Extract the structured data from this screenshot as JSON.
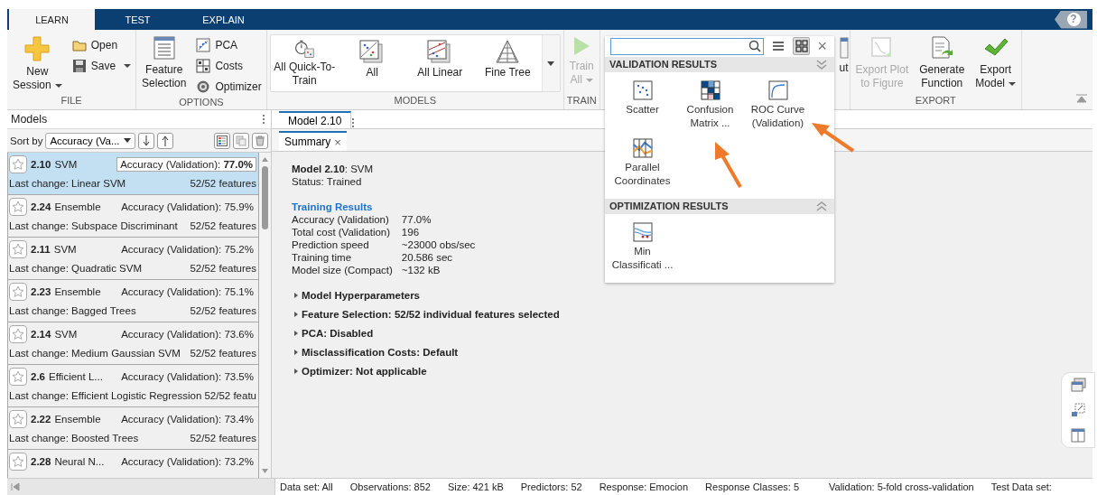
{
  "tabs": [
    {
      "label": "LEARN",
      "selected": true
    },
    {
      "label": "TEST",
      "selected": false
    },
    {
      "label": "EXPLAIN",
      "selected": false
    }
  ],
  "help_button": "?",
  "toolstrip": {
    "sections": [
      {
        "title": "FILE",
        "items": [
          {
            "kind": "large",
            "label": "New\nSession",
            "dropdown": true,
            "disabled": false
          },
          {
            "kind": "small",
            "label": "Open",
            "dropdown": false,
            "disabled": false
          },
          {
            "kind": "small",
            "label": "Save",
            "dropdown": true,
            "disabled": false
          }
        ]
      },
      {
        "title": "OPTIONS",
        "items": [
          {
            "kind": "large",
            "label": "Feature\nSelection",
            "dropdown": false,
            "disabled": false
          },
          {
            "kind": "small",
            "label": "PCA",
            "dropdown": false,
            "disabled": false
          },
          {
            "kind": "small",
            "label": "Costs",
            "dropdown": false,
            "disabled": false
          },
          {
            "kind": "small",
            "label": "Optimizer",
            "dropdown": false,
            "disabled": false
          }
        ]
      },
      {
        "title": "MODELS",
        "items": [
          {
            "kind": "gallery",
            "label": "All Quick-To-\nTrain",
            "dropdown": false,
            "disabled": false
          },
          {
            "kind": "gallery",
            "label": "All",
            "dropdown": false,
            "disabled": false
          },
          {
            "kind": "gallery",
            "label": "All Linear",
            "dropdown": false,
            "disabled": false
          },
          {
            "kind": "gallery",
            "label": "Fine Tree",
            "dropdown": false,
            "disabled": false
          }
        ]
      },
      {
        "title": "TRAIN",
        "items": [
          {
            "kind": "large",
            "label": "Train\nAll",
            "dropdown": true,
            "disabled": true
          }
        ]
      },
      {
        "items": [
          {
            "kind": "large",
            "label": "ut",
            "dropdown": false,
            "disabled": false
          }
        ]
      },
      {
        "title": "EXPORT",
        "items": [
          {
            "kind": "large",
            "label": "Export Plot\nto Figure",
            "dropdown": false,
            "disabled": true
          },
          {
            "kind": "large",
            "label": "Generate\nFunction",
            "dropdown": false,
            "disabled": false
          },
          {
            "kind": "large",
            "label": "Export\nModel",
            "dropdown": true,
            "disabled": false
          }
        ]
      }
    ]
  },
  "models_panel": {
    "title": "Models",
    "sort_label": "Sort by",
    "sort_value": "Accuracy (Va...",
    "models": [
      {
        "number": "2.10",
        "type": "SVM",
        "metric": "Accuracy (Validation): **77.0%**",
        "last_change": "Last change: Linear SVM",
        "features": "52/52 features",
        "selected": true
      },
      {
        "number": "2.24",
        "type": "Ensemble",
        "metric": "Accuracy (Validation): 75.9%",
        "last_change": "Last change: Subspace Discriminant",
        "features": "52/52 features",
        "selected": false
      },
      {
        "number": "2.11",
        "type": "SVM",
        "metric": "Accuracy (Validation): 75.2%",
        "last_change": "Last change: Quadratic SVM",
        "features": "52/52 features",
        "selected": false
      },
      {
        "number": "2.23",
        "type": "Ensemble",
        "metric": "Accuracy (Validation): 75.1%",
        "last_change": "Last change: Bagged Trees",
        "features": "52/52 features",
        "selected": false
      },
      {
        "number": "2.14",
        "type": "SVM",
        "metric": "Accuracy (Validation): 73.6%",
        "last_change": "Last change: Medium Gaussian SVM",
        "features": "52/52 features",
        "selected": false
      },
      {
        "number": "2.6",
        "type": "Efficient L...",
        "metric": "Accuracy (Validation): 73.5%",
        "last_change": "Last change: Efficient Logistic Regression",
        "features": "52/52 featu",
        "selected": false
      },
      {
        "number": "2.22",
        "type": "Ensemble",
        "metric": "Accuracy (Validation): 73.4%",
        "last_change": "Last change: Boosted Trees",
        "features": "52/52 features",
        "selected": false
      },
      {
        "number": "2.28",
        "type": "Neural N...",
        "metric": "Accuracy (Validation): 73.2%",
        "selected": false
      }
    ]
  },
  "document": {
    "tab": "Model 2.10",
    "sub_tab": "Summary",
    "close": "×",
    "summary": {
      "title": "**Model 2.10**: SVM",
      "status": "Status: Trained",
      "section_title": "Training Results",
      "rows": [
        {
          "label": "Accuracy (Validation)",
          "value": "77.0%"
        },
        {
          "label": "Total cost (Validation)",
          "value": "196"
        },
        {
          "label": "Prediction speed",
          "value": "~23000 obs/sec"
        },
        {
          "label": "Training time",
          "value": "20.586 sec"
        },
        {
          "label": "Model size (Compact)",
          "value": "~132 kB"
        }
      ],
      "collapsibles": [
        {
          "label": "Model Hyperparameters",
          "expanded": false
        },
        {
          "label": "Feature Selection: 52/52 individual features selected",
          "expanded": false
        },
        {
          "label": "PCA: Disabled",
          "expanded": false
        },
        {
          "label": "Misclassification Costs: Default",
          "expanded": false
        },
        {
          "label": "Optimizer: Not applicable",
          "expanded": false
        }
      ]
    }
  },
  "plot_gallery": {
    "views": [
      {
        "kind": "list",
        "selected": false
      },
      {
        "kind": "grid",
        "selected": true
      }
    ],
    "close": "×",
    "sections": [
      {
        "title": "VALIDATION RESULTS",
        "items": [
          {
            "label": "Scatter"
          },
          {
            "label": "Confusion Matrix ..."
          },
          {
            "label": "ROC Curve (Validation)"
          },
          {
            "label": "Parallel Coordinates"
          }
        ]
      },
      {
        "title": "OPTIMIZATION RESULTS",
        "items": [
          {
            "label": "Min Classificati ..."
          }
        ]
      }
    ]
  },
  "status_bar": [
    "Data set: All",
    "Observations: 852",
    "Size: 421 kB",
    "Predictors: 52",
    "Response: Emocion",
    "Response Classes: 5",
    "Validation: 5-fold cross-validation",
    "Test Data set:"
  ]
}
